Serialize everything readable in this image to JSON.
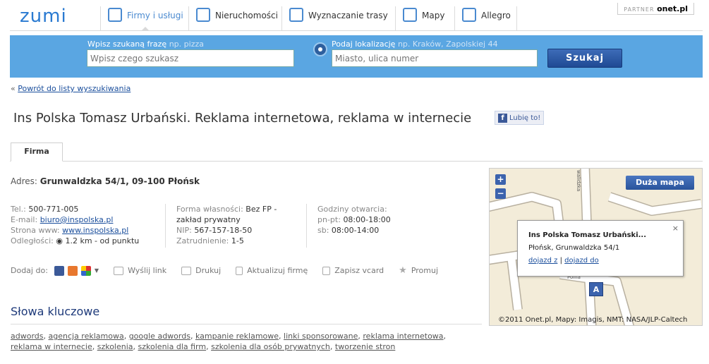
{
  "header": {
    "logo": "zumi",
    "tabs": [
      {
        "label": "Firmy i usługi",
        "icon": "briefcase-icon"
      },
      {
        "label": "Nieruchomości",
        "icon": "house-icon"
      },
      {
        "label": "Wyznaczanie trasy",
        "icon": "road-icon"
      },
      {
        "label": "Mapy",
        "icon": "map-icon"
      },
      {
        "label": "Allegro",
        "icon": "hand-icon"
      }
    ],
    "partner_label": "PARTNER",
    "partner_brand": "onet.pl"
  },
  "search": {
    "phrase_label": "Wpisz szukaną frazę",
    "phrase_hint": "np. pizza",
    "phrase_placeholder": "Wpisz czego szukasz",
    "location_label": "Podaj lokalizację",
    "location_hint": "np. Kraków, Zapolskiej 44",
    "location_placeholder": "Miasto, ulica numer",
    "button": "Szukaj"
  },
  "back_link": {
    "prefix": "«",
    "label": "Powrót do listy wyszukiwania"
  },
  "company": {
    "title": "Ins Polska Tomasz Urbański. Reklama internetowa, reklama w internecie",
    "like_label": "Lubię to!",
    "tab": "Firma",
    "address_label": "Adres:",
    "address": "Grunwaldzka 54/1, 09-100 Płońsk"
  },
  "contact": {
    "tel_label": "Tel.:",
    "tel": "500-771-005",
    "email_label": "E-mail:",
    "email": "biuro@inspolska.pl",
    "www_label": "Strona www:",
    "www": "www.inspolska.pl",
    "distance_label": "Odległości:",
    "distance": "1.2 km - od punktu"
  },
  "legal": {
    "form_label": "Forma własności:",
    "form_line1": "Bez FP -",
    "form_line2": "zakład prywatny",
    "nip_label": "NIP:",
    "nip": "567-157-18-50",
    "employment_label": "Zatrudnienie:",
    "employment": "1-5"
  },
  "hours": {
    "label": "Godziny otwarcia:",
    "weekday_label": "pn-pt:",
    "weekday": "08:00-18:00",
    "saturday_label": "sb:",
    "saturday": "08:00-14:00"
  },
  "actions": {
    "add_label": "Dodaj do:",
    "send": "Wyślij link",
    "print": "Drukuj",
    "update": "Aktualizuj firmę",
    "vcard": "Zapisz vcard",
    "promote": "Promuj"
  },
  "keywords": {
    "title": "Słowa kluczowe",
    "items": [
      "adwords",
      "agencja reklamowa",
      "google adwords",
      "kampanie reklamowe",
      "linki sponsorowane",
      "reklama internetowa",
      "reklama w internecie",
      "szkolenia",
      "szkolenia dla firm",
      "szkolenia dla osób prywatnych",
      "tworzenie stron"
    ]
  },
  "map": {
    "zoom_in": "+",
    "zoom_out": "−",
    "big_map_button": "Duża mapa",
    "popup_title": "Ins Polska Tomasz Urbański...",
    "popup_address": "Płońsk, Grunwaldzka 54/1",
    "directions_to": "dojazd z",
    "directions_sep": "|",
    "directions_from": "dojazd do",
    "close": "×",
    "marker": "A",
    "street_1": "walidzka",
    "street_2": "Polna",
    "copyright": "©2011 Onet.pl, Mapy: Imagis, NMT: NASA/JLP-Caltech"
  },
  "colors": {
    "accent": "#5aa6e2",
    "button": "#2a549c",
    "link": "#1a4e9c"
  }
}
